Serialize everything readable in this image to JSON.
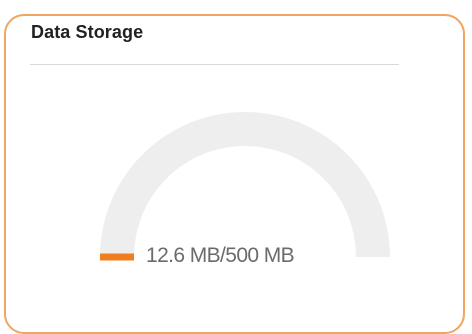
{
  "widget": {
    "title": "Data Storage",
    "usage_label": "12.6 MB/500 MB",
    "used_mb": 12.6,
    "total_mb": 500,
    "used_fraction": 0.0252
  },
  "colors": {
    "border": "#f0a560",
    "accent": "#f07d1e",
    "track": "#eeeeee",
    "title_text": "#222222",
    "value_text": "#6b6b6b",
    "divider": "#d9d9d9"
  }
}
